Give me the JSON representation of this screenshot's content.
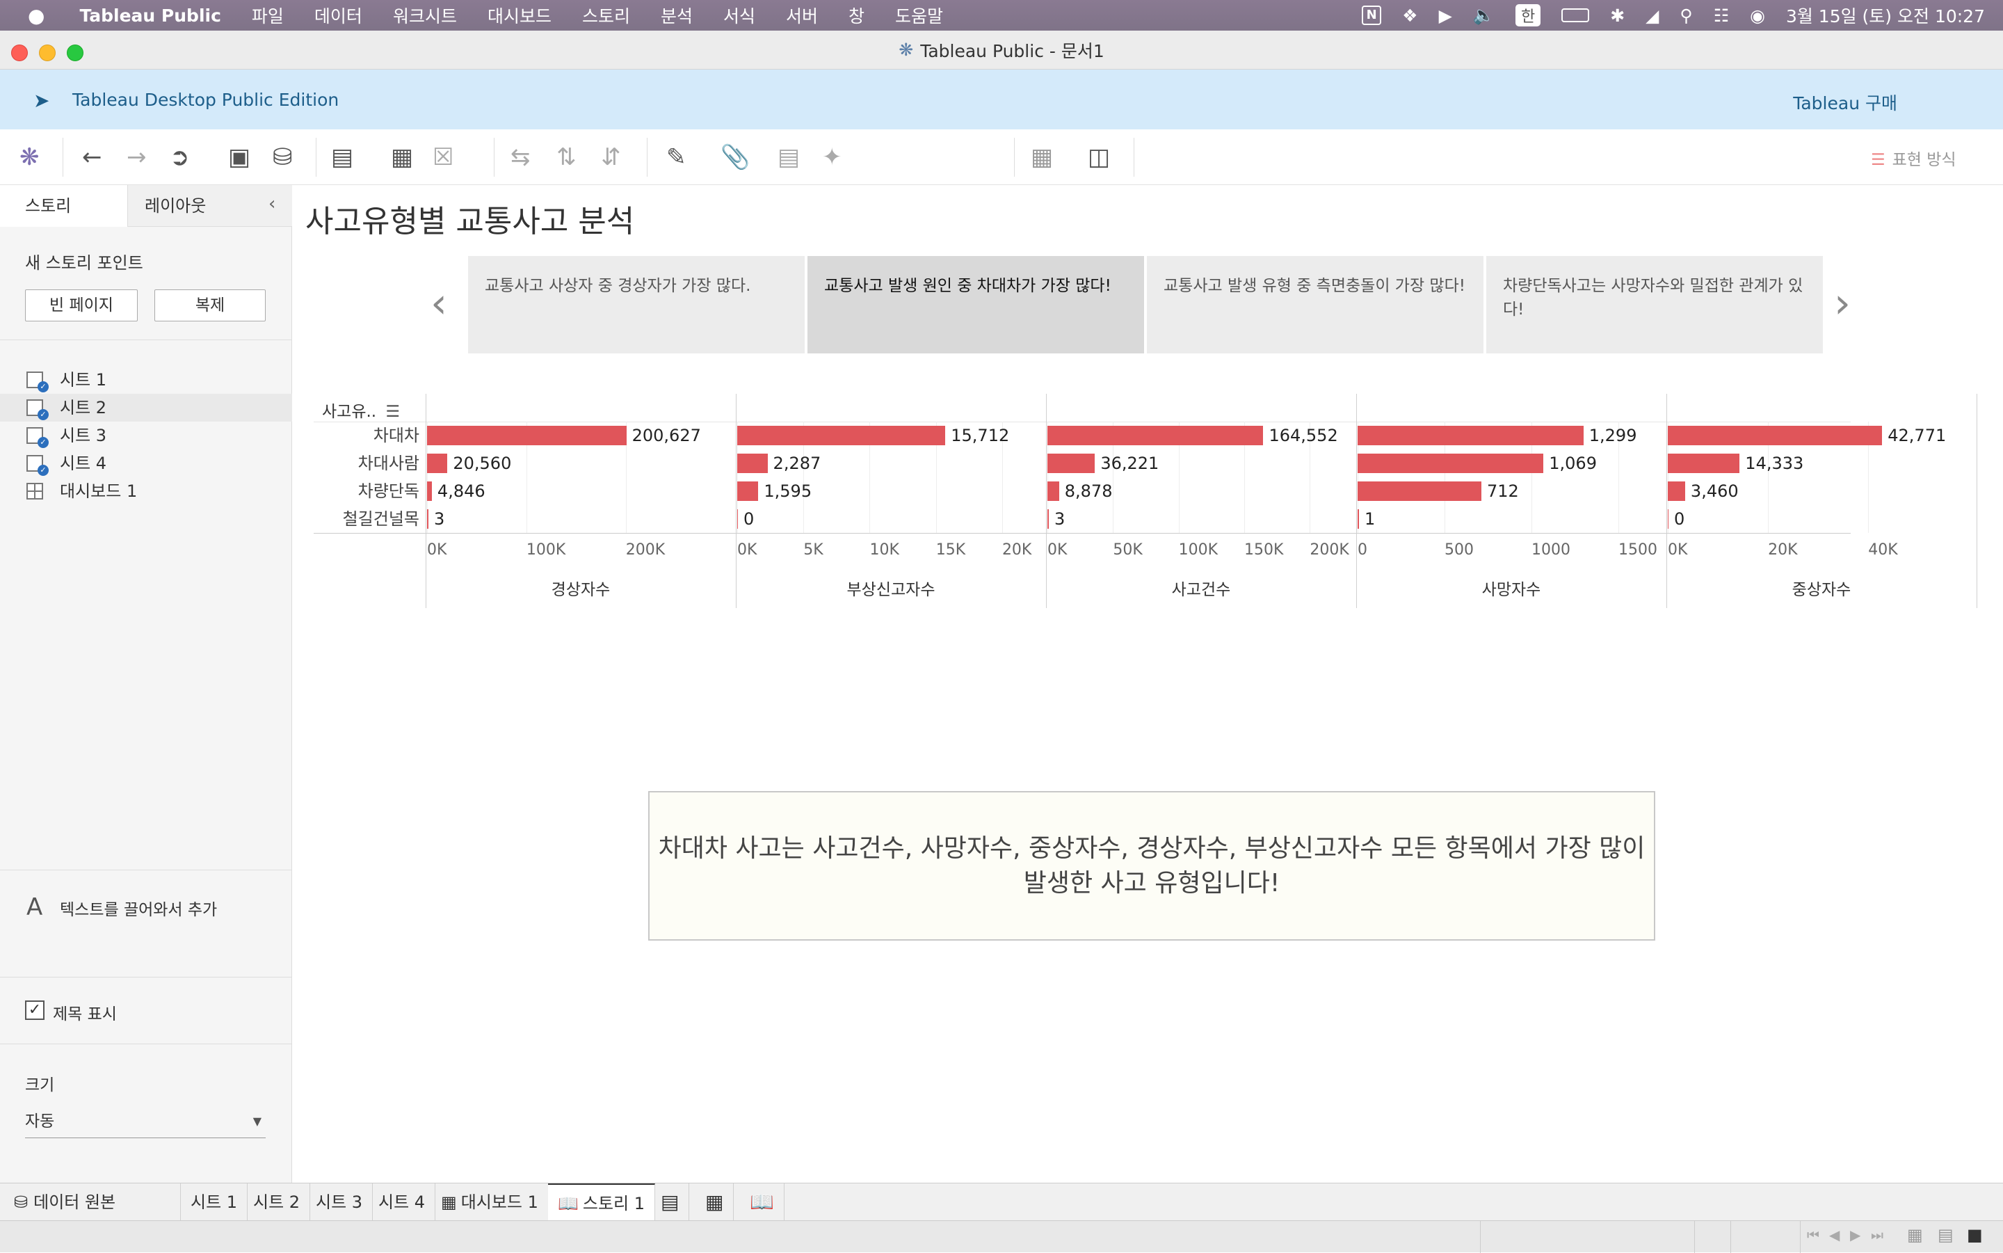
{
  "menubar": {
    "apple_icon": "apple-logo",
    "app_name": "Tableau Public",
    "items": [
      "파일",
      "데이터",
      "워크시트",
      "대시보드",
      "스토리",
      "분석",
      "서식",
      "서버",
      "창",
      "도움말"
    ],
    "input_source": "한",
    "clock": "3월 15일 (토) 오전 10:27"
  },
  "window": {
    "title": "Tableau Public - 문서1"
  },
  "banner": {
    "edition": "Tableau Desktop Public Edition",
    "buy_link": "Tableau 구매"
  },
  "toolbar": {
    "show_me": "표현 방식"
  },
  "sidebar": {
    "tab_story": "스토리",
    "tab_layout": "레이아웃",
    "new_story_point": "새 스토리 포인트",
    "blank_button": "빈 페이지",
    "duplicate_button": "복제",
    "sheets": [
      "시트 1",
      "시트 2",
      "시트 3",
      "시트 4",
      "대시보드 1"
    ],
    "drag_text": "텍스트를 끌어와서 추가",
    "show_title": "제목 표시",
    "size_label": "크기",
    "size_value": "자동"
  },
  "story": {
    "title": "사고유형별 교통사고 분석",
    "points": [
      "교통사고 사상자 중 경상자가 가장 많다.",
      "교통사고 발생 원인 중 차대차가 가장 많다!",
      "교통사고 발생 유형 중 측면충돌이 가장 많다!",
      "차량단독사고는 사망자수와 밀접한 관계가 있다!"
    ],
    "active_point": 1,
    "row_header": "사고유..",
    "caption": "차대차 사고는 사고건수, 사망자수, 중상자수, 경상자수, 부상신고자수 모든 항목에서 가장 많이 발생한 사고 유형입니다!"
  },
  "chart_data": {
    "type": "bar",
    "orientation": "horizontal",
    "categories": [
      "차대차",
      "차대사람",
      "차량단독",
      "철길건널목"
    ],
    "row_field": "사고유..",
    "color": "#e0555a",
    "series": [
      {
        "name": "경상자수",
        "values": [
          200627,
          20560,
          4846,
          3
        ],
        "labels": [
          "200,627",
          "20,560",
          "4,846",
          "3"
        ],
        "axis_max": 280000,
        "ticks": [
          0,
          100000,
          200000
        ],
        "tick_labels": [
          "0K",
          "100K",
          "200K"
        ]
      },
      {
        "name": "부상신고자수",
        "values": [
          15712,
          2287,
          1595,
          0
        ],
        "labels": [
          "15,712",
          "2,287",
          "1,595",
          "0"
        ],
        "axis_max": 21000,
        "ticks": [
          0,
          5000,
          10000,
          15000,
          20000
        ],
        "tick_labels": [
          "0K",
          "5K",
          "10K",
          "15K",
          "20K"
        ]
      },
      {
        "name": "사고건수",
        "values": [
          164552,
          36221,
          8878,
          3
        ],
        "labels": [
          "164,552",
          "36,221",
          "8,878",
          "3"
        ],
        "axis_max": 212000,
        "ticks": [
          0,
          50000,
          100000,
          150000,
          200000
        ],
        "tick_labels": [
          "0K",
          "50K",
          "100K",
          "150K",
          "200K"
        ]
      },
      {
        "name": "사망자수",
        "values": [
          1299,
          1069,
          712,
          1
        ],
        "labels": [
          "1,299",
          "1,069",
          "712",
          "1"
        ],
        "axis_max": 1600,
        "ticks": [
          0,
          500,
          1000,
          1500
        ],
        "tick_labels": [
          "0",
          "500",
          "1000",
          "1500"
        ]
      },
      {
        "name": "중상자수",
        "values": [
          42771,
          14333,
          3460,
          0
        ],
        "labels": [
          "42,771",
          "14,333",
          "3,460",
          "0"
        ],
        "axis_max": 55500,
        "ticks": [
          0,
          20000,
          40000
        ],
        "tick_labels": [
          "0K",
          "20K",
          "40K"
        ]
      }
    ]
  },
  "bottom_tabs": {
    "data_source": "데이터 원본",
    "tabs": [
      "시트 1",
      "시트 2",
      "시트 3",
      "시트 4",
      "대시보드 1",
      "스토리 1"
    ]
  }
}
